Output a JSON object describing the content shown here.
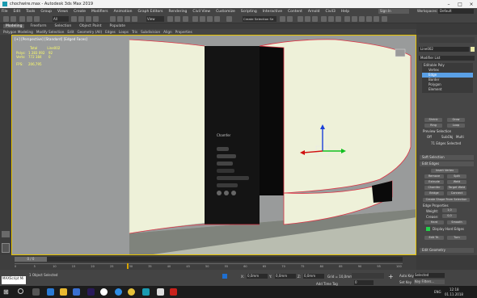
{
  "window": {
    "title": "chochwire.max - Autodesk 3ds Max 2019",
    "sign_in": "Sign In",
    "workspace_label": "Workspaces:",
    "workspace_value": "Default"
  },
  "menu": [
    "File",
    "Edit",
    "Tools",
    "Group",
    "Views",
    "Create",
    "Modifiers",
    "Animation",
    "Graph Editors",
    "Rendering",
    "Civil View",
    "Customize",
    "Scripting",
    "Interactive",
    "Content",
    "Arnold",
    "Civil3",
    "Help"
  ],
  "toolbar": {
    "view_dropdown": "All",
    "coord_dropdown": "View",
    "selection_set": "Create Selection Se"
  },
  "ribbon": {
    "tabs": [
      "Modeling",
      "Freeform",
      "Selection",
      "Object Paint",
      "Populate"
    ],
    "active_tab": "Modeling",
    "sub": [
      "Polygon Modeling",
      "Modify Selection",
      "Edit",
      "Geometry (All)",
      "Edges",
      "Loops",
      "Tris",
      "Subdivision",
      "Align",
      "Properties"
    ]
  },
  "viewport": {
    "label": "[+] [Perspective] [Standard] [Edged Faces]",
    "stats_header": [
      "Total",
      "Line002"
    ],
    "stats": [
      {
        "name": "Polys:",
        "total": "1 283 092",
        "obj": "92"
      },
      {
        "name": "Verts:",
        "total": "772 384",
        "obj": "0"
      }
    ],
    "fps_label": "FPS:",
    "fps_value": "206,795",
    "caddy_title": "Chamfer"
  },
  "command_panel": {
    "object_name": "Line002",
    "modifier_list": "Modifier List",
    "stack": [
      "Editable Poly",
      "Vertex",
      "Edge",
      "Border",
      "Polygon",
      "Element"
    ],
    "selected_stack": "Edge",
    "buttons1": [
      "Shrink",
      "Grow",
      "Ring",
      "Loop"
    ],
    "preview_label": "Preview Selection",
    "preview_options": [
      "Off",
      "SubObj",
      "Multi"
    ],
    "edges_selected": "71 Edges Selected",
    "rollouts": [
      "Soft Selection",
      "Edit Edges",
      "Edit Geometry"
    ],
    "edit_edges": [
      "Insert Vertex",
      "Remove",
      "Split",
      "Extrude",
      "Weld",
      "Chamfer",
      "Target Weld",
      "Bridge",
      "Connect",
      "Create Shape From Selection"
    ],
    "edge_props": "Edge Properties",
    "weight_label": "Weight:",
    "weight_value": "1,0",
    "crease_label": "Crease:",
    "crease_value": "0,0",
    "hard_smooth": [
      "Hard",
      "Smooth"
    ],
    "display_hard": "Display Hard Edges",
    "edit_tri": [
      "Edit Tri.",
      "Turn"
    ]
  },
  "trackbar": {
    "frame": "0 / 0",
    "ticks": [
      "0",
      "5",
      "10",
      "15",
      "20",
      "25",
      "30",
      "35",
      "40",
      "45",
      "50",
      "55",
      "60",
      "65",
      "70",
      "75",
      "80",
      "85",
      "90",
      "95",
      "100"
    ]
  },
  "status": {
    "script_input": "MAXScript Mi",
    "selected": "1 Object Selected",
    "x_label": "X:",
    "x_value": "0,0mm",
    "y_label": "Y:",
    "y_value": "0,0mm",
    "z_label": "Z:",
    "z_value": "0,0mm",
    "grid": "Grid = 10,0mm",
    "add_time_tag": "Add Time Tag",
    "auto_key": "Auto Key",
    "selected_dd": "Selected",
    "set_key": "Set Key",
    "key_filters": "Key Filters...",
    "frame_value": "0"
  },
  "taskbar": {
    "time": "12:18",
    "date": "01.11.2018",
    "lang": "ENG"
  },
  "colors": {
    "accent": "#5aa0e6",
    "viewport_border": "#e6c200",
    "panel": "#464646",
    "wall": "#e8ecd6"
  }
}
